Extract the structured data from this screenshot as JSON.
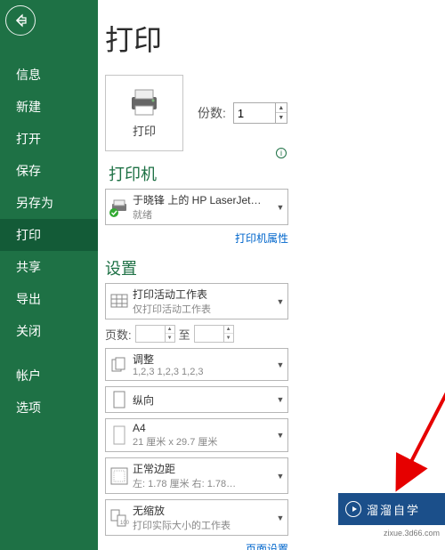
{
  "sidebar": {
    "items": [
      {
        "label": "信息"
      },
      {
        "label": "新建"
      },
      {
        "label": "打开"
      },
      {
        "label": "保存"
      },
      {
        "label": "另存为"
      },
      {
        "label": "打印"
      },
      {
        "label": "共享"
      },
      {
        "label": "导出"
      },
      {
        "label": "关闭"
      }
    ],
    "footerItems": [
      {
        "label": "帐户"
      },
      {
        "label": "选项"
      }
    ],
    "selectedIndex": 5
  },
  "header": {
    "title": "打印"
  },
  "printButton": {
    "label": "打印"
  },
  "copies": {
    "label": "份数:",
    "value": "1"
  },
  "sections": {
    "printer": "打印机",
    "settings": "设置"
  },
  "printer": {
    "name": "于晓锋 上的 HP LaserJet…",
    "status": "就绪"
  },
  "links": {
    "printerProperties": "打印机属性",
    "pageSetup": "页面设置"
  },
  "settings": {
    "scope": {
      "title": "打印活动工作表",
      "sub": "仅打印活动工作表"
    },
    "pages": {
      "label": "页数:",
      "to": "至"
    },
    "collate": {
      "title": "调整",
      "sub": "1,2,3    1,2,3    1,2,3"
    },
    "orientation": {
      "title": "纵向",
      "sub": ""
    },
    "paper": {
      "title": "A4",
      "sub": "21 厘米 x 29.7 厘米"
    },
    "margins": {
      "title": "正常边距",
      "sub": "左:  1.78 厘米    右:  1.78…"
    },
    "scaling": {
      "title": "无缩放",
      "sub": "打印实际大小的工作表"
    }
  },
  "watermark": {
    "brand": "溜溜自学",
    "url": "zixue.3d66.com"
  }
}
